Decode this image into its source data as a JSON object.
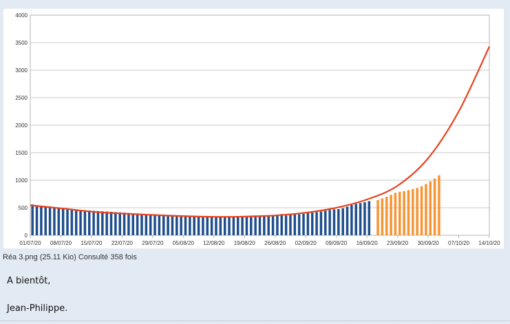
{
  "chart_data": {
    "type": "bar",
    "ylim": [
      0,
      4000
    ],
    "y_ticks": [
      0,
      500,
      1000,
      1500,
      2000,
      2500,
      3000,
      3500,
      4000
    ],
    "x_tick_labels": [
      "01/07/20",
      "08/07/20",
      "15/07/20",
      "22/07/20",
      "29/07/20",
      "05/08/20",
      "12/08/20",
      "19/08/20",
      "26/08/20",
      "02/09/20",
      "09/09/20",
      "16/09/20",
      "23/09/20",
      "30/09/20",
      "07/10/20",
      "14/10/20"
    ],
    "x_range_days": [
      0,
      105
    ],
    "grid": "horizontal",
    "colors": {
      "observed": "#1f4e8c",
      "projected": "#f79433",
      "trend": "#e8401c"
    },
    "series": [
      {
        "kind": "bar",
        "color_key": "observed",
        "start_date": "01/07/20",
        "values": [
          560,
          545,
          535,
          525,
          515,
          505,
          495,
          490,
          480,
          475,
          470,
          460,
          455,
          450,
          445,
          440,
          435,
          430,
          425,
          420,
          415,
          410,
          405,
          400,
          395,
          390,
          385,
          380,
          375,
          370,
          365,
          360,
          358,
          355,
          352,
          350,
          348,
          346,
          344,
          342,
          340,
          345,
          338,
          336,
          334,
          335,
          337,
          340,
          345,
          348,
          350,
          352,
          355,
          358,
          360,
          365,
          370,
          385,
          360,
          370,
          375,
          380,
          390,
          400,
          410,
          420,
          430,
          445,
          460,
          470,
          475,
          490,
          520,
          550,
          570,
          585,
          600,
          620
        ]
      },
      {
        "kind": "bar",
        "color_key": "projected",
        "start_date": "18/09/20",
        "values": [
          640,
          670,
          700,
          735,
          770,
          790,
          800,
          820,
          840,
          860,
          890,
          930,
          980,
          1030,
          1090
        ]
      },
      {
        "kind": "line",
        "color_key": "trend",
        "x_dates": [
          "01/07/20",
          "08/07/20",
          "15/07/20",
          "22/07/20",
          "29/07/20",
          "05/08/20",
          "12/08/20",
          "19/08/20",
          "26/08/20",
          "02/09/20",
          "09/09/20",
          "16/09/20",
          "23/09/20",
          "30/09/20",
          "07/10/20",
          "14/10/20"
        ],
        "values": [
          545,
          490,
          430,
          395,
          370,
          348,
          335,
          340,
          360,
          410,
          500,
          650,
          900,
          1400,
          2250,
          3430
        ]
      }
    ]
  },
  "caption": "Réa 3.png (25.11 Kio) Consulté 358 fois",
  "message": {
    "greeting": "A bientôt,",
    "signature": "Jean-Philippe."
  }
}
